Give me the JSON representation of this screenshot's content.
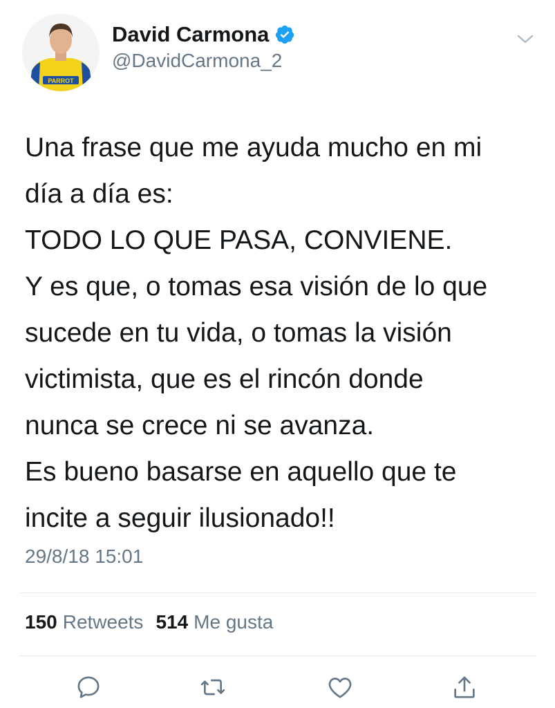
{
  "author": {
    "display_name": "David Carmona",
    "handle": "@DavidCarmona_2",
    "verified_icon": "verified-badge-icon",
    "avatar_jersey_text": "PARROT",
    "avatar_icon": "avatar-photo"
  },
  "tweet": {
    "lines": [
      "Una frase que me ayuda mucho en mi",
      "día a día es:",
      "TODO LO QUE PASA, CONVIENE.",
      "Y es que, o tomas esa visión de lo que",
      "sucede en tu vida, o tomas la visión",
      "victimista, que es el rincón donde",
      "nunca se crece ni se avanza.",
      "Es bueno basarse en aquello que te",
      "incite a seguir ilusionado!!"
    ],
    "timestamp": "29/8/18 15:01"
  },
  "stats": {
    "retweets_count": "150",
    "retweets_label": "Retweets",
    "likes_count": "514",
    "likes_label": "Me gusta"
  },
  "actions": {
    "reply_icon": "reply-icon",
    "retweet_icon": "retweet-icon",
    "like_icon": "heart-icon",
    "share_icon": "share-icon"
  },
  "colors": {
    "text_primary": "#14171a",
    "text_secondary": "#657786",
    "verified_blue": "#1da1f2",
    "divider": "#e1e8ed",
    "jersey_yellow": "#f2d21b"
  }
}
